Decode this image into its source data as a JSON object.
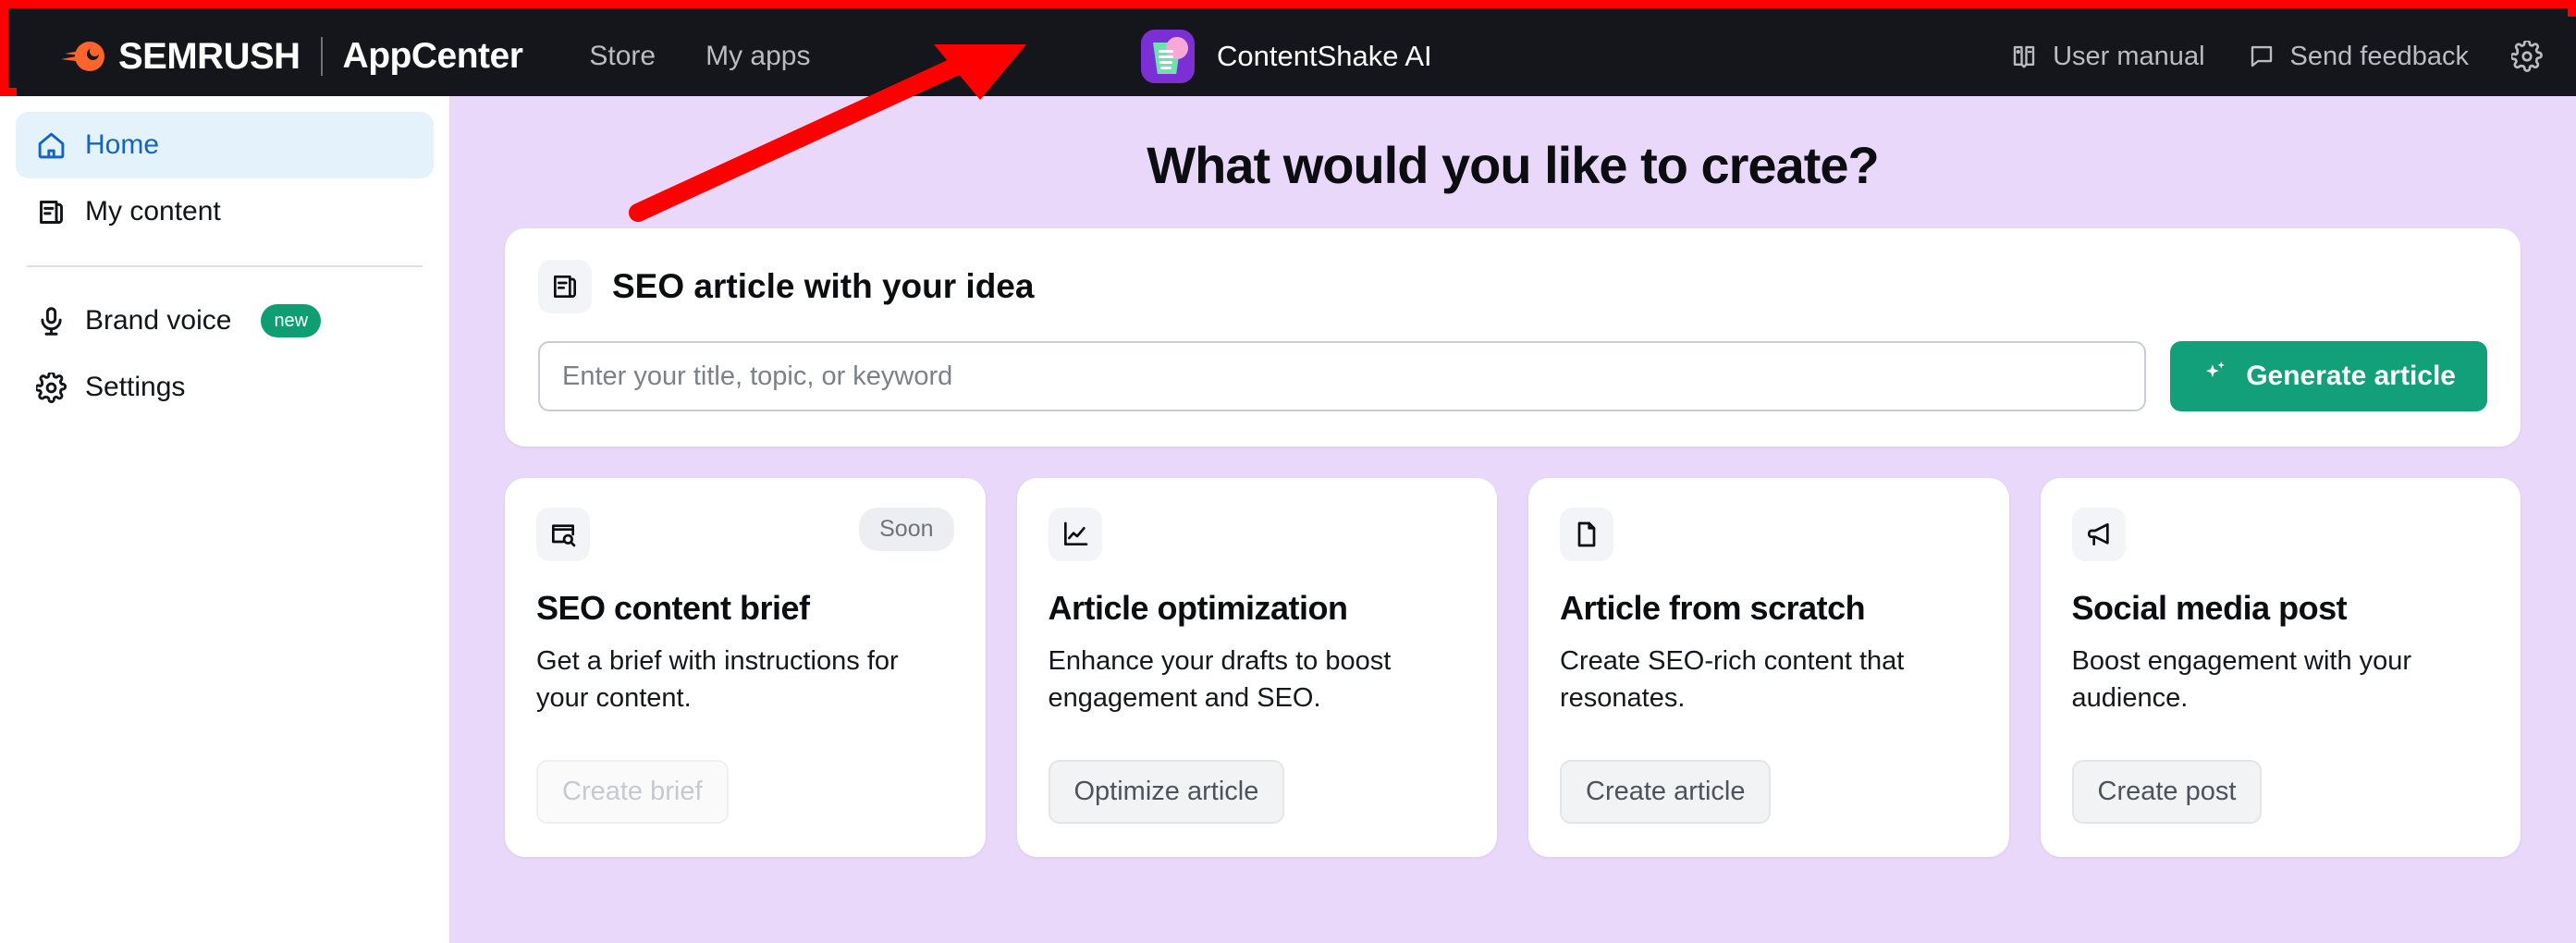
{
  "header": {
    "brand_primary": "SEMRUSH",
    "brand_secondary": "AppCenter",
    "nav": [
      {
        "label": "Store"
      },
      {
        "label": "My apps"
      }
    ],
    "app_name": "ContentShake AI",
    "right_items": [
      {
        "label": "User manual",
        "icon": "book-icon"
      },
      {
        "label": "Send feedback",
        "icon": "speech-bubble-icon"
      }
    ],
    "settings_icon": "gear-icon",
    "bg_color": "#14161B",
    "accent_color": "#FF642D",
    "annotation_color": "#FF0000"
  },
  "sidebar": {
    "items": [
      {
        "label": "Home",
        "icon": "home-icon",
        "active": true
      },
      {
        "label": "My content",
        "icon": "content-doc-icon",
        "active": false
      },
      {
        "label": "Brand voice",
        "icon": "microphone-icon",
        "badge": "new",
        "active": false
      },
      {
        "label": "Settings",
        "icon": "gear-icon",
        "active": false
      }
    ],
    "active_color": "#1464C0",
    "active_bg": "#E4F2FC",
    "badge_color": "#0E9E72"
  },
  "main": {
    "bg_color": "#E9D8FA",
    "page_title": "What would you like to create?",
    "seo_card": {
      "icon": "document-lines-icon",
      "title": "SEO article with your idea",
      "input_placeholder": "Enter your title, topic, or keyword",
      "input_value": "",
      "button_label": "Generate article",
      "button_icon": "sparkle-icon",
      "button_color": "#11A07A"
    },
    "cards": [
      {
        "icon": "browser-search-icon",
        "badge": "Soon",
        "title": "SEO content brief",
        "description": "Get a brief with instructions for your content.",
        "button_label": "Create brief",
        "disabled": true
      },
      {
        "icon": "line-chart-icon",
        "badge": "",
        "title": "Article optimization",
        "description": "Enhance your drafts to boost engagement and SEO.",
        "button_label": "Optimize article",
        "disabled": false
      },
      {
        "icon": "file-icon",
        "badge": "",
        "title": "Article from scratch",
        "description": "Create SEO-rich content that resonates.",
        "button_label": "Create article",
        "disabled": false
      },
      {
        "icon": "megaphone-icon",
        "badge": "",
        "title": "Social media post",
        "description": "Boost engagement with your audience.",
        "button_label": "Create post",
        "disabled": false
      }
    ]
  },
  "annotation": {
    "type": "arrow",
    "color": "#FF0000",
    "points_to": "header-bar"
  }
}
